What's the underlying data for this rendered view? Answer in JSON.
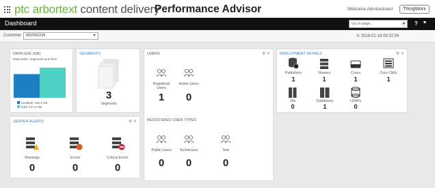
{
  "header": {
    "brand": "ptc arbortext",
    "brand_sub": " content delivery",
    "product": "Performance Advisor",
    "welcome": "Welcome Administrator",
    "logo": "ThingWorx"
  },
  "titlebar": {
    "title": "Dashboard",
    "goto_placeholder": "Go to page...",
    "help_icon": "?",
    "comment_icon": "❞"
  },
  "filter": {
    "customer_label": "Customer",
    "customer_value": "6R2002239",
    "refresh_time": "2018-01-18 09:32:04"
  },
  "data_size": {
    "title": "DATA SIZE (GB)",
    "subtitle": "Data folder, Segments and Files",
    "available_label": "Available: 116.1 GB",
    "total_label": "Total: 147.6 GB",
    "colors": {
      "available": "#1e7fc4",
      "used": "#4fd1c5"
    },
    "chart_data": {
      "type": "bar",
      "series": [
        {
          "name": "Available",
          "value": 116.1
        },
        {
          "name": "Total",
          "value": 147.6
        }
      ]
    }
  },
  "segments": {
    "title": "SEGMENTS",
    "count": "3",
    "label": "Segments"
  },
  "users": {
    "title": "USERS",
    "items": [
      {
        "label": "Registered Users",
        "value": "1"
      },
      {
        "label": "Active Users",
        "value": "0"
      }
    ]
  },
  "registered_user_types": {
    "title": "REGISTERED USER TYPES",
    "items": [
      {
        "label": "Public Users",
        "value": "0"
      },
      {
        "label": "Technicians",
        "value": "0"
      },
      {
        "label": "Test",
        "value": "0"
      }
    ]
  },
  "server_alerts": {
    "title": "SERVER ALERTS",
    "items": [
      {
        "label": "Warnings",
        "value": "0"
      },
      {
        "label": "Errors",
        "value": "0"
      },
      {
        "label": "Critical Errors",
        "value": "0"
      }
    ]
  },
  "deployment": {
    "title": "DEPLOYMENT DETAILS",
    "items": [
      {
        "label": "Publishers",
        "value": "1"
      },
      {
        "label": "Viewers",
        "value": "1"
      },
      {
        "label": "Cores",
        "value": "1"
      },
      {
        "label": "Core CMIs",
        "value": "1"
      },
      {
        "label": "18s",
        "value": "0"
      },
      {
        "label": "Databases",
        "value": "1"
      },
      {
        "label": "LDAPs",
        "value": "0"
      }
    ]
  },
  "panel_controls": "⚙ ✕"
}
